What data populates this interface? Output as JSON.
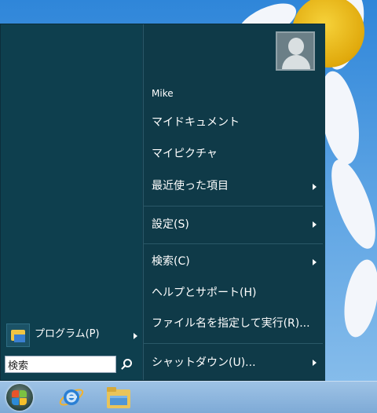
{
  "start_menu": {
    "user_name": "Mike",
    "right_items": [
      {
        "label": "マイドキュメント",
        "has_submenu": false
      },
      {
        "label": "マイピクチャ",
        "has_submenu": false
      },
      {
        "label": "最近使った項目",
        "has_submenu": true
      },
      {
        "label": "設定(S)",
        "has_submenu": true
      },
      {
        "label": "検索(C)",
        "has_submenu": true
      },
      {
        "label": "ヘルプとサポート(H)",
        "has_submenu": false
      },
      {
        "label": "ファイル名を指定して実行(R)...",
        "has_submenu": false
      },
      {
        "label": "シャットダウン(U)...",
        "has_submenu": true
      }
    ],
    "programs_label": "プログラム(P)",
    "search": {
      "value": "検索"
    }
  },
  "taskbar": {
    "icons": [
      "start-orb-icon",
      "internet-explorer-icon",
      "file-explorer-icon"
    ]
  },
  "colors": {
    "menu_background": "#0f3a48",
    "left_pane": "#0e3f4e",
    "separator": "#2a5868",
    "taskbar": "#8fb7de"
  }
}
